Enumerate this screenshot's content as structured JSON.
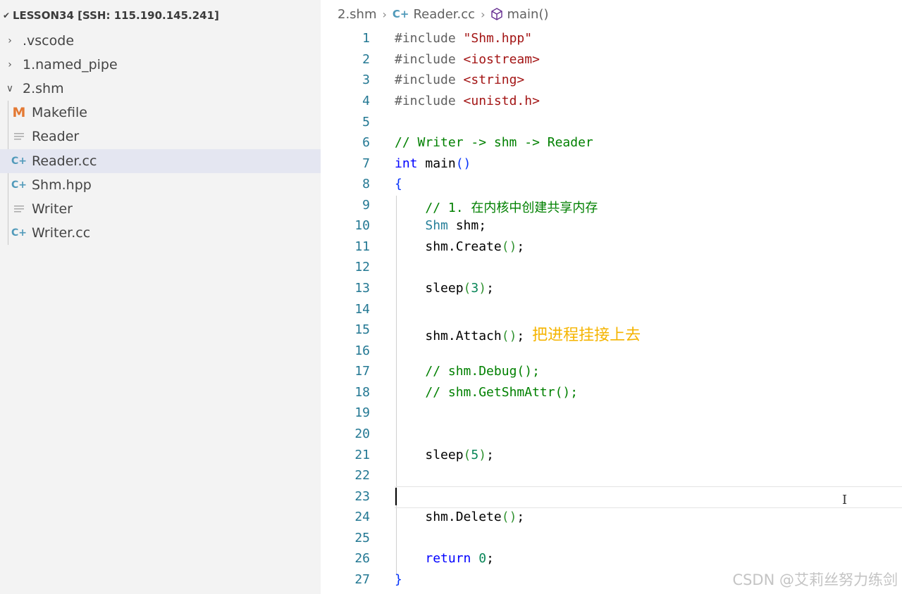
{
  "explorer": {
    "root_label": "LESSON34 [SSH: 115.190.145.241]",
    "items": [
      {
        "label": ".vscode",
        "kind": "folder",
        "expanded": false
      },
      {
        "label": "1.named_pipe",
        "kind": "folder",
        "expanded": false
      },
      {
        "label": "2.shm",
        "kind": "folder",
        "expanded": true
      },
      {
        "label": "Makefile",
        "kind": "makefile"
      },
      {
        "label": "Reader",
        "kind": "text"
      },
      {
        "label": "Reader.cc",
        "kind": "cpp",
        "selected": true
      },
      {
        "label": "Shm.hpp",
        "kind": "cpp"
      },
      {
        "label": "Writer",
        "kind": "text"
      },
      {
        "label": "Writer.cc",
        "kind": "cpp"
      }
    ],
    "icons": {
      "makefile": "M",
      "cpp": "C+"
    }
  },
  "breadcrumb": {
    "folder": "2.shm",
    "file": "Reader.cc",
    "symbol": "main()"
  },
  "line_numbers": [
    "1",
    "2",
    "3",
    "4",
    "5",
    "6",
    "7",
    "8",
    "9",
    "10",
    "11",
    "12",
    "13",
    "14",
    "15",
    "16",
    "17",
    "18",
    "19",
    "20",
    "21",
    "22",
    "23",
    "24",
    "25",
    "26",
    "27"
  ],
  "code": {
    "l1_pre": "#include ",
    "l1_str": "\"Shm.hpp\"",
    "l2_pre": "#include ",
    "l2_str": "<iostream>",
    "l3_pre": "#include ",
    "l3_str": "<string>",
    "l4_pre": "#include ",
    "l4_str": "<unistd.h>",
    "l6_cmt": "// Writer -> shm -> Reader",
    "l7_kw": "int",
    "l7_fn": " main",
    "l7_paren": "()",
    "l8_brace": "{",
    "l9_cmt": "// 1. 在内核中创建共享内存",
    "l10_type": "Shm",
    "l10_rest": " shm;",
    "l11_a": "shm.Create",
    "l11_p": "()",
    "l11_b": ";",
    "l13_a": "sleep",
    "l13_p1": "(",
    "l13_n": "3",
    "l13_p2": ")",
    "l13_b": ";",
    "l15_a": "shm.Attach",
    "l15_p": "()",
    "l15_b": ";",
    "l15_annot": "把进程挂接上去",
    "l17_cmt": "// shm.Debug();",
    "l18_cmt": "// shm.GetShmAttr();",
    "l21_a": "sleep",
    "l21_p1": "(",
    "l21_n": "5",
    "l21_p2": ")",
    "l21_b": ";",
    "l24_a": "shm.Delete",
    "l24_p": "()",
    "l24_b": ";",
    "l26_kw": "return",
    "l26_sp": " ",
    "l26_n": "0",
    "l26_b": ";",
    "l27_brace": "}"
  },
  "watermark": "CSDN @艾莉丝努力练剑",
  "colors": {
    "sidebar_bg": "#f3f3f3",
    "selected_row": "#e4e6f1",
    "line_number": "#237893",
    "keyword": "#0000ff",
    "string": "#a31515",
    "comment": "#008000",
    "type": "#267f99",
    "number": "#098658",
    "annotation": "#f5b400"
  }
}
